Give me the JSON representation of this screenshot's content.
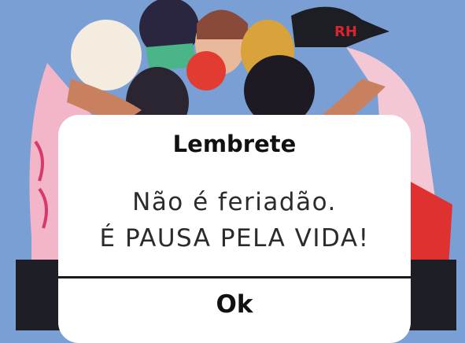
{
  "background": {
    "image": "illustration-group-of-women",
    "color": "#7a9fd4",
    "cap_text": "RH"
  },
  "dialog": {
    "title": "Lembrete",
    "message_line1": "Não é feriadão.",
    "message_line2": "É PAUSA PELA VIDA!",
    "ok_label": "Ok"
  }
}
